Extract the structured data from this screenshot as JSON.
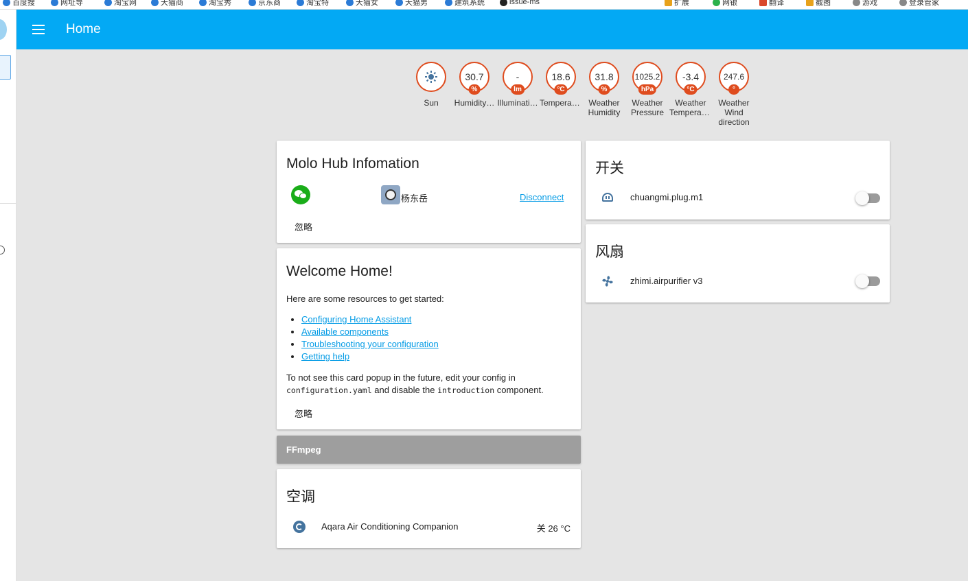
{
  "browser": {
    "bookmarks": [
      "百度搜",
      "网址导",
      "淘宝网",
      "天猫商",
      "淘宝秀",
      "京东商",
      "淘宝特",
      "天猫女",
      "天猫男",
      "建筑系统",
      "issue-ms"
    ],
    "right_items": [
      "扩展",
      "网银",
      "翻译",
      "截图",
      "游戏",
      "登录管家"
    ]
  },
  "header": {
    "title": "Home",
    "menu_icon": "menu-icon"
  },
  "badges": [
    {
      "value": "",
      "unit": "",
      "label": "Sun",
      "icon": "sun-icon"
    },
    {
      "value": "30.7",
      "unit": "%",
      "label": "Humidity…"
    },
    {
      "value": "-",
      "unit": "lm",
      "label": "Illuminati…"
    },
    {
      "value": "18.6",
      "unit": "°C",
      "label": "Temperat…"
    },
    {
      "value": "31.8",
      "unit": "%",
      "label": "Weather Humidity"
    },
    {
      "value": "1025.2",
      "unit": "hPa",
      "label": "Weather Pressure"
    },
    {
      "value": "-3.4",
      "unit": "°C",
      "label": "Weather Temperat…"
    },
    {
      "value": "247.6",
      "unit": "°",
      "label": "Weather Wind direction"
    }
  ],
  "molo": {
    "title": "Molo Hub Infomation",
    "user_name": "杨东岳",
    "disconnect_label": "Disconnect",
    "dismiss_label": "忽略"
  },
  "welcome": {
    "title": "Welcome Home!",
    "intro": "Here are some resources to get started:",
    "links": [
      "Configuring Home Assistant",
      "Available components",
      "Troubleshooting your configuration",
      "Getting help"
    ],
    "note_before": "To not see this card popup in the future, edit your config in",
    "note_code1": "configuration.yaml",
    "note_middle": "and disable the",
    "note_code2": "introduction",
    "note_after": "component.",
    "dismiss_label": "忽略"
  },
  "ffmpeg": {
    "title": "FFmpeg"
  },
  "climate": {
    "title": "空调",
    "entity": "Aqara Air Conditioning Companion",
    "state": "关 26 °C"
  },
  "switch_card": {
    "title": "开关",
    "entity": "chuangmi.plug.m1",
    "state": false
  },
  "fan_card": {
    "title": "风扇",
    "entity": "zhimi.airpurifier v3",
    "state": false
  },
  "colors": {
    "accent": "#03a9f4",
    "badge": "#df4c1e",
    "link": "#039be5",
    "icon": "#44739e"
  }
}
